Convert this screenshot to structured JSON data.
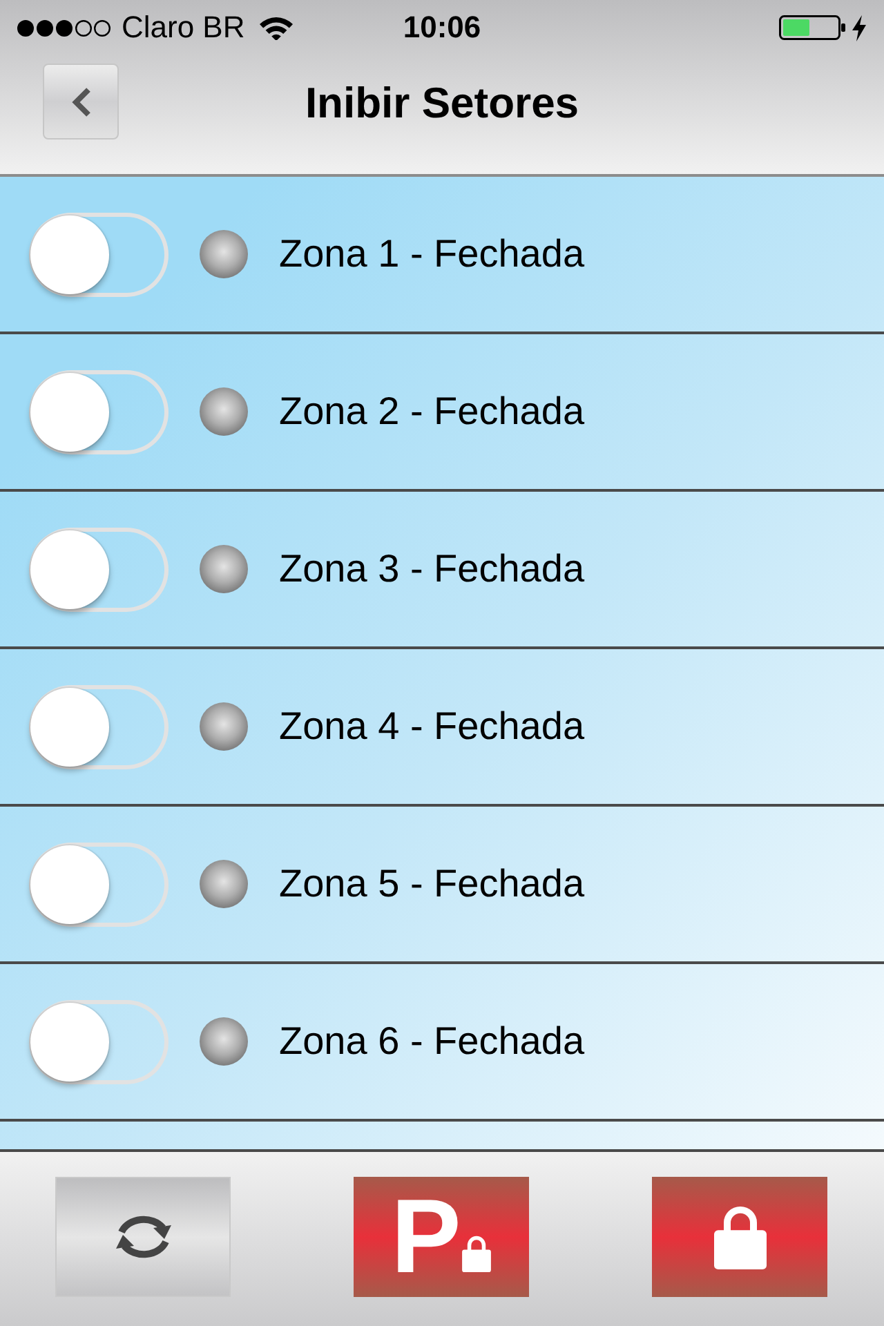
{
  "status_bar": {
    "carrier": "Claro BR",
    "time": "10:06"
  },
  "nav_bar": {
    "title": "Inibir Setores"
  },
  "zones": [
    {
      "label": "Zona 1 - Fechada",
      "on": false
    },
    {
      "label": "Zona 2 - Fechada",
      "on": false
    },
    {
      "label": "Zona 3 - Fechada",
      "on": false
    },
    {
      "label": "Zona 4 - Fechada",
      "on": false
    },
    {
      "label": "Zona 5 - Fechada",
      "on": false
    },
    {
      "label": "Zona 6 - Fechada",
      "on": false
    }
  ],
  "toolbar": {
    "buttons": [
      {
        "kind": "refresh"
      },
      {
        "kind": "partial_arm",
        "letter": "P"
      },
      {
        "kind": "lock"
      }
    ]
  }
}
